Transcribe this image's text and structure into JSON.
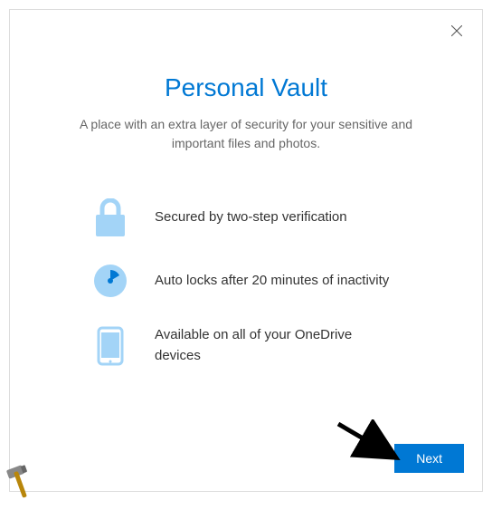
{
  "dialog": {
    "title": "Personal Vault",
    "subtitle": "A place with an extra layer of security for your sensitive and important files and photos.",
    "features": [
      {
        "icon": "lock-icon",
        "text": "Secured by two-step verification"
      },
      {
        "icon": "clock-icon",
        "text": "Auto locks after 20 minutes of inactivity"
      },
      {
        "icon": "phone-icon",
        "text": "Available on all of your OneDrive devices"
      }
    ],
    "next_label": "Next"
  },
  "colors": {
    "accent": "#0078d4",
    "icon_light": "#a3d4f7"
  }
}
